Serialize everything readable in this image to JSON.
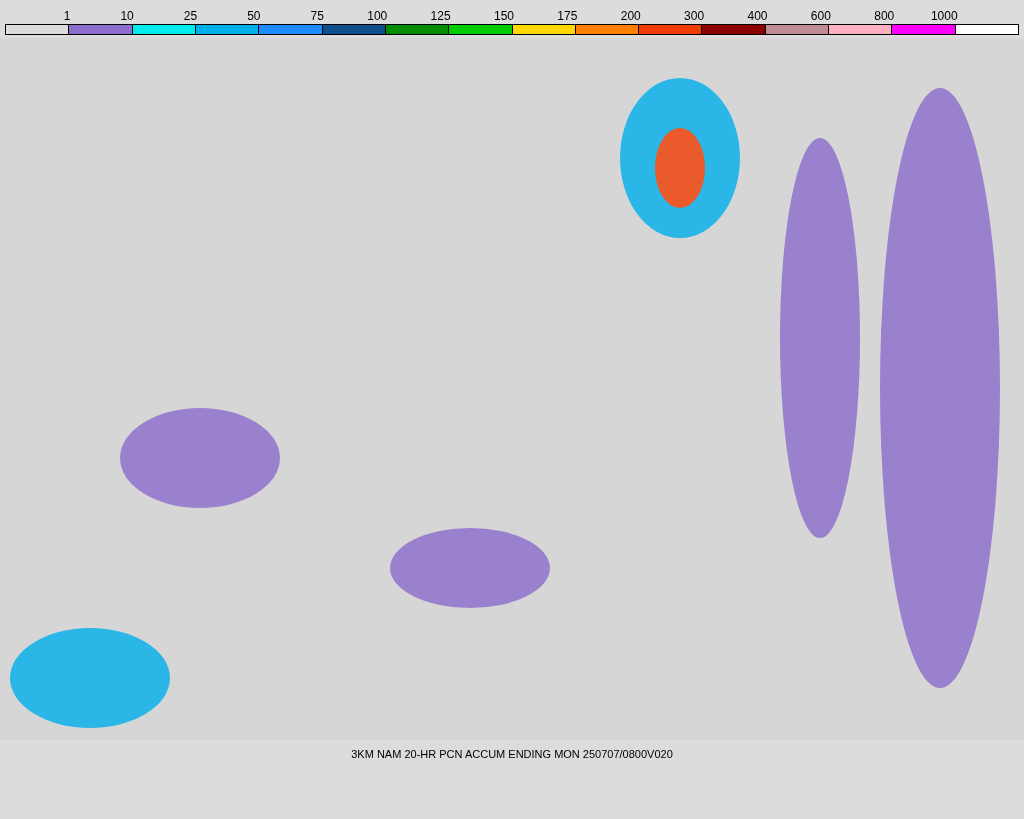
{
  "legend": {
    "swatches": [
      {
        "color": "#dcdcdc",
        "label": "1"
      },
      {
        "color": "#8c6ccc",
        "label": "10"
      },
      {
        "color": "#00ecec",
        "label": "25"
      },
      {
        "color": "#00b0ec",
        "label": "50"
      },
      {
        "color": "#1e8cff",
        "label": "75"
      },
      {
        "color": "#104e8c",
        "label": "100"
      },
      {
        "color": "#008c00",
        "label": "125"
      },
      {
        "color": "#00cc00",
        "label": "150"
      },
      {
        "color": "#ffd700",
        "label": "175"
      },
      {
        "color": "#ff8000",
        "label": "200"
      },
      {
        "color": "#f03c00",
        "label": "300"
      },
      {
        "color": "#8c0000",
        "label": "400"
      },
      {
        "color": "#c08c96",
        "label": "600"
      },
      {
        "color": "#ffb0c0",
        "label": "800"
      },
      {
        "color": "#ff00ff",
        "label": "1000"
      },
      {
        "color": "#ffffff"
      }
    ]
  },
  "caption": "3KM NAM 20-HR PCN ACCUM ENDING MON 250707/0800V020"
}
